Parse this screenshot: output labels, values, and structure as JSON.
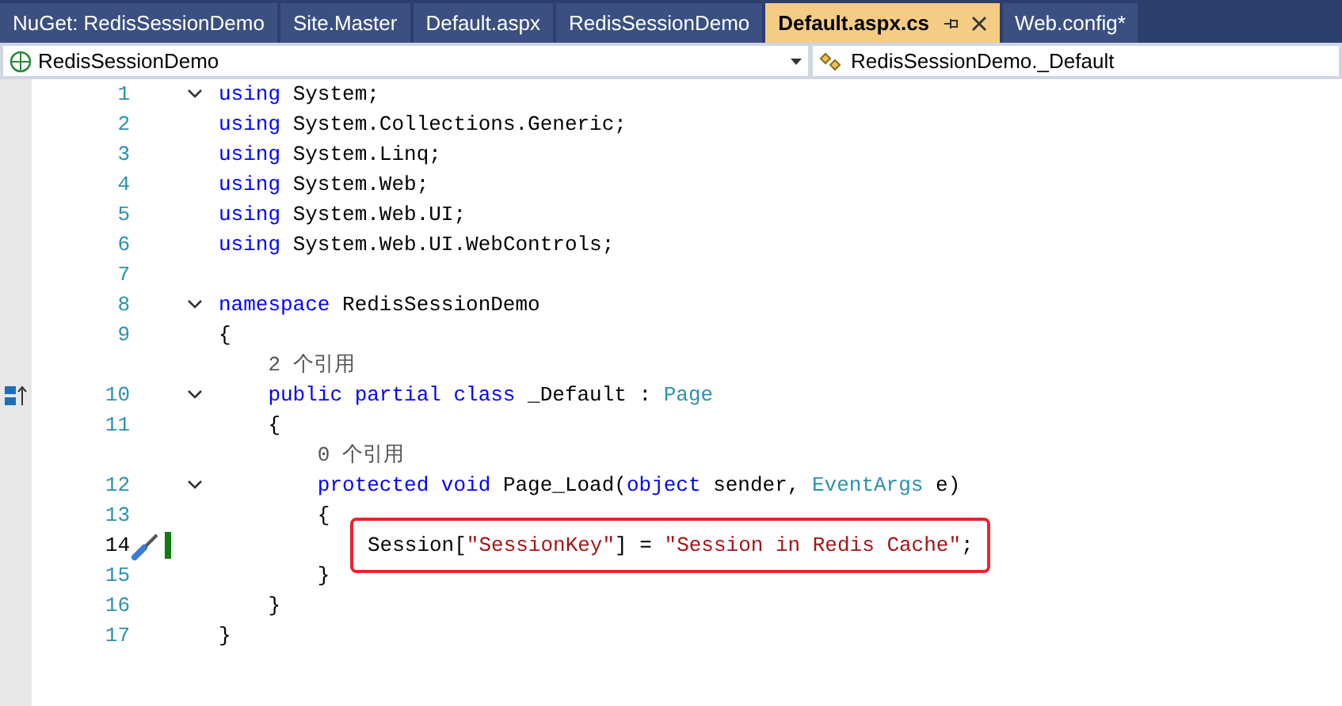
{
  "tabs": [
    {
      "label": "NuGet: RedisSessionDemo",
      "selected": false
    },
    {
      "label": "Site.Master",
      "selected": false
    },
    {
      "label": "Default.aspx",
      "selected": false
    },
    {
      "label": "RedisSessionDemo",
      "selected": false
    },
    {
      "label": "Default.aspx.cs",
      "selected": true
    },
    {
      "label": "Web.config*",
      "selected": false
    }
  ],
  "nav": {
    "project": "RedisSessionDemo",
    "member": "RedisSessionDemo._Default"
  },
  "lines": [
    {
      "kind": "code",
      "number": "1",
      "expanded": true,
      "tokens": [
        {
          "t": "using",
          "kind": "keyword"
        },
        {
          "t": " System;",
          "kind": "plain"
        }
      ]
    },
    {
      "kind": "code",
      "number": "2",
      "tokens": [
        {
          "t": "using",
          "kind": "keyword"
        },
        {
          "t": " System.Collections.Generic;",
          "kind": "plain"
        }
      ]
    },
    {
      "kind": "code",
      "number": "3",
      "tokens": [
        {
          "t": "using",
          "kind": "keyword"
        },
        {
          "t": " System.Linq;",
          "kind": "plain"
        }
      ]
    },
    {
      "kind": "code",
      "number": "4",
      "tokens": [
        {
          "t": "using",
          "kind": "keyword"
        },
        {
          "t": " System.Web;",
          "kind": "plain"
        }
      ]
    },
    {
      "kind": "code",
      "number": "5",
      "tokens": [
        {
          "t": "using",
          "kind": "keyword"
        },
        {
          "t": " System.Web.UI;",
          "kind": "plain"
        }
      ]
    },
    {
      "kind": "code",
      "number": "6",
      "tokens": [
        {
          "t": "using",
          "kind": "keyword"
        },
        {
          "t": " System.Web.UI.WebControls;",
          "kind": "plain"
        }
      ]
    },
    {
      "kind": "code",
      "number": "7"
    },
    {
      "kind": "code",
      "number": "8",
      "expanded": true,
      "tokens": [
        {
          "t": "namespace",
          "kind": "keyword"
        },
        {
          "t": " RedisSessionDemo",
          "kind": "plain"
        }
      ]
    },
    {
      "kind": "code",
      "number": "9",
      "tokens": [
        {
          "t": "{",
          "kind": "plain"
        }
      ]
    },
    {
      "kind": "codelens",
      "text": "    2 个引用"
    },
    {
      "kind": "code",
      "number": "10",
      "expanded": true,
      "marker": true,
      "tokens": [
        {
          "t": "    public partial class",
          "kind": "keyword"
        },
        {
          "t": " _Default : ",
          "kind": "plain"
        },
        {
          "t": "Page",
          "kind": "type"
        }
      ]
    },
    {
      "kind": "code",
      "number": "11",
      "tokens": [
        {
          "t": "    {",
          "kind": "plain"
        }
      ]
    },
    {
      "kind": "codelens",
      "text": "        0 个引用"
    },
    {
      "kind": "code",
      "number": "12",
      "expanded": true,
      "tokens": [
        {
          "t": "        protected void",
          "kind": "keyword"
        },
        {
          "t": " Page_Load(",
          "kind": "plain"
        },
        {
          "t": "object",
          "kind": "keyword"
        },
        {
          "t": " sender, ",
          "kind": "plain"
        },
        {
          "t": "EventArgs",
          "kind": "type"
        },
        {
          "t": " e)",
          "kind": "plain"
        }
      ]
    },
    {
      "kind": "code",
      "number": "13",
      "tokens": [
        {
          "t": "        {",
          "kind": "plain"
        }
      ]
    },
    {
      "kind": "code",
      "number": "14",
      "current": true,
      "highlighted": true,
      "tokens": [
        {
          "t": "Session[",
          "kind": "plain"
        },
        {
          "t": "\"SessionKey\"",
          "kind": "string"
        },
        {
          "t": "] = ",
          "kind": "plain"
        },
        {
          "t": "\"Session in Redis Cache\"",
          "kind": "string"
        },
        {
          "t": ";",
          "kind": "plain"
        }
      ]
    },
    {
      "kind": "code",
      "number": "15",
      "tokens": [
        {
          "t": "        }",
          "kind": "plain"
        }
      ]
    },
    {
      "kind": "code",
      "number": "16",
      "tokens": [
        {
          "t": "    }",
          "kind": "plain"
        }
      ]
    },
    {
      "kind": "code",
      "number": "17",
      "tokens": [
        {
          "t": "}",
          "kind": "plain"
        }
      ]
    }
  ]
}
